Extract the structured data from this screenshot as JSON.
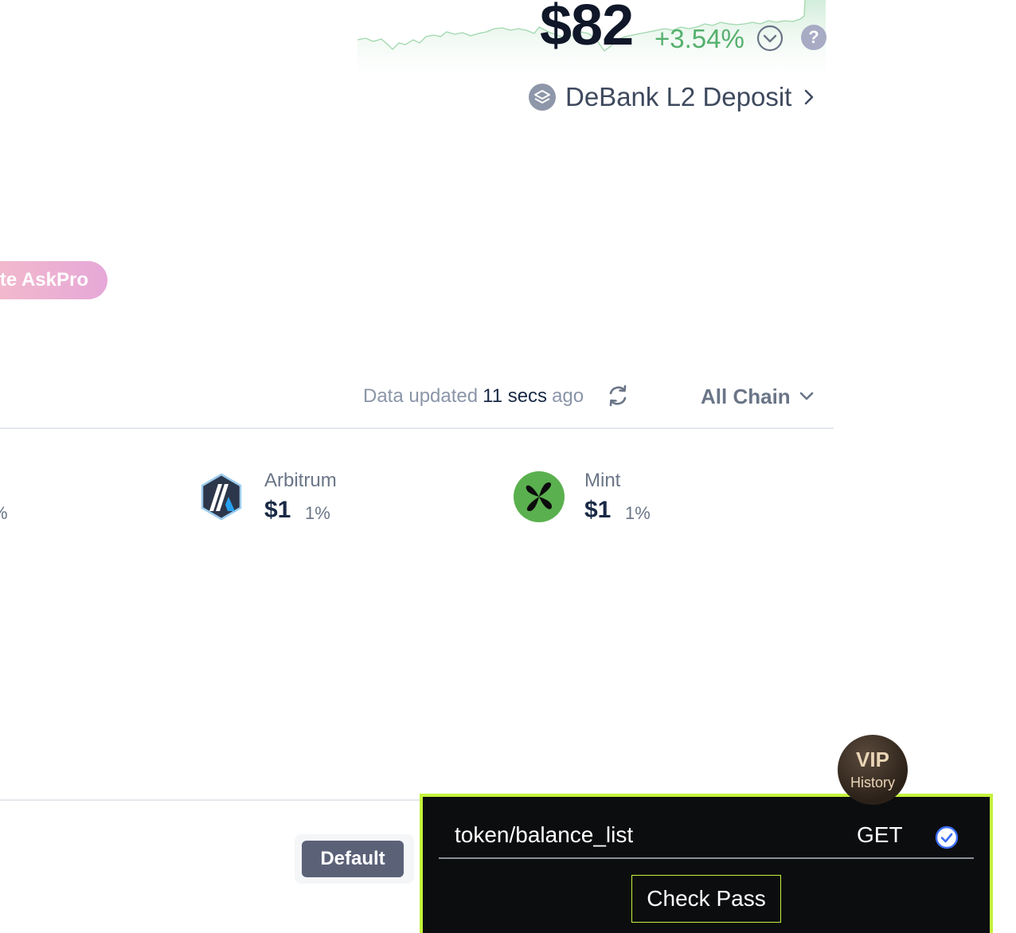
{
  "header": {
    "balance": "$82",
    "change": "+3.54%",
    "change_color": "#56b06e",
    "deposit_link_label": "DeBank L2 Deposit",
    "help_icon_glyph": "?"
  },
  "promo": {
    "askpro_label": "te AskPro"
  },
  "status": {
    "prefix": "Data updated",
    "time": "11 secs",
    "suffix": "ago",
    "chain_filter": "All Chain"
  },
  "chains": [
    {
      "name": "Arbitrum",
      "value": "$1",
      "percent": "1%",
      "icon": "arbitrum-icon"
    },
    {
      "name": "Mint",
      "value": "$1",
      "percent": "1%",
      "icon": "mint-icon"
    }
  ],
  "partial_chain_percent": "%",
  "actions": {
    "default_label": "Default"
  },
  "vip": {
    "title": "VIP",
    "subtitle": "History"
  },
  "api_panel": {
    "path": "token/balance_list",
    "method": "GET",
    "check_button": "Check Pass",
    "accent_color": "#c4f23c"
  }
}
